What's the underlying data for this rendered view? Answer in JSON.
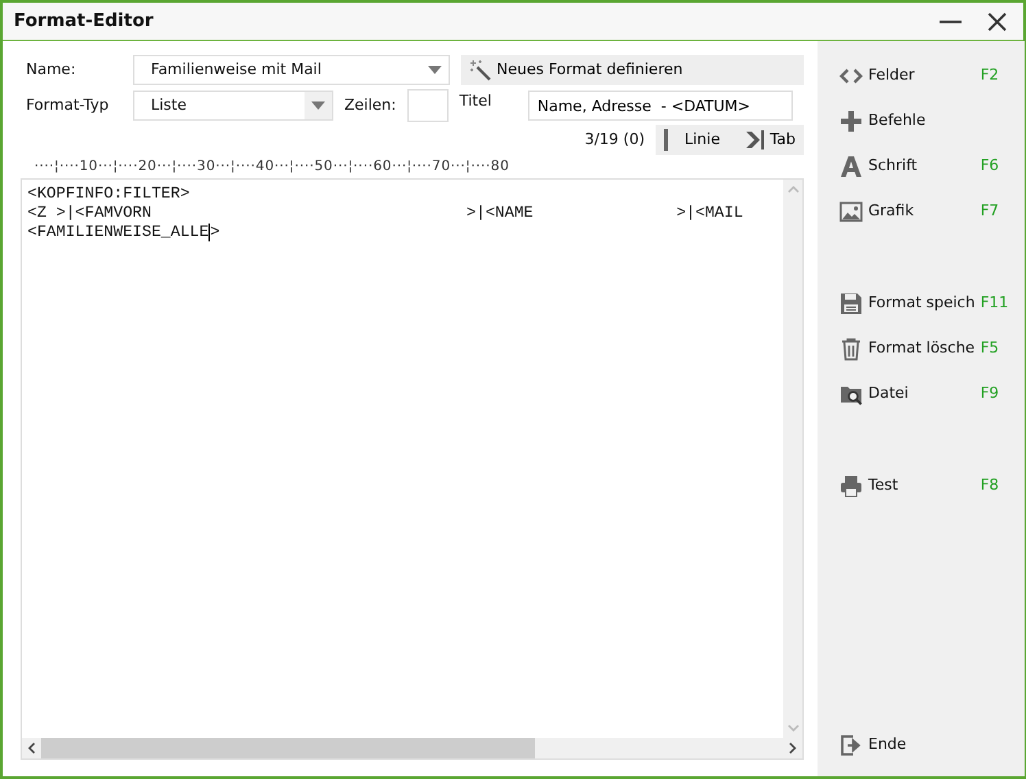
{
  "window": {
    "title": "Format-Editor",
    "buttons": [
      {
        "kind": "minimize"
      },
      {
        "kind": "close"
      }
    ]
  },
  "form": {
    "name_label": "Name:",
    "name_value": "Familienweise mit Mail",
    "new_format_button": "Neues Format definieren",
    "type_label": "Format-Typ",
    "type_value": "Liste",
    "rows_label": "Zeilen:",
    "title_label": "Titel",
    "title_value": "Name, Adresse  - <DATUM>",
    "position": "3/19 (0)",
    "line_button": "Linie",
    "tab_button": "Tab"
  },
  "ruler": "····¦····10···¦····20···¦····30···¦····40···¦····50···¦····60···¦····70···¦····80",
  "editor": {
    "lines": [
      {
        "text": "<KOPFINFO:FILTER>",
        "cursor": false
      },
      {
        "text": "<Z >|<FAMVORN                                 >|<NAME               >|<MAIL",
        "cursor": false
      },
      {
        "text": "<FAMILIENWEISE_ALLE>",
        "cursor": true
      }
    ]
  },
  "sidebar": {
    "groups": [
      [
        {
          "label": "Felder",
          "key": "F2"
        },
        {
          "label": "Befehle"
        },
        {
          "label": "Schrift",
          "key": "F6"
        },
        {
          "label": "Grafik",
          "key": "F7"
        }
      ],
      [
        {
          "label": "Format speich",
          "key": "F11"
        },
        {
          "label": "Format lösche",
          "key": "F5"
        },
        {
          "label": "Datei",
          "key": "F9"
        }
      ],
      [
        {
          "label": "Test",
          "key": "F8"
        }
      ]
    ],
    "bottom": [
      {
        "label": "Ende"
      }
    ]
  }
}
